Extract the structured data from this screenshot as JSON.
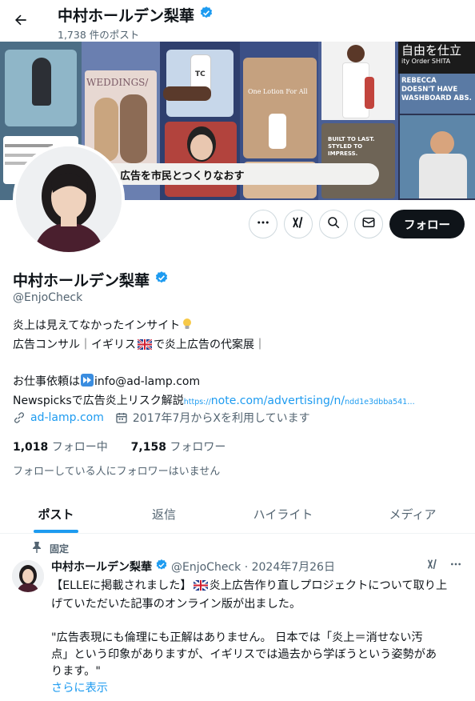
{
  "header": {
    "title": "中村ホールデン梨華",
    "post_count": "1,738 件のポスト"
  },
  "banner": {
    "strip_text": "広告を市民とつくりなおす",
    "weddings_text": "WEDDINGS/",
    "tc_label": "TC",
    "lotion_text": "One Lotion For All",
    "rebecca_text": "REBECCA DOESN'T HAVE WASHBOARD ABS.",
    "built_text": "BUILT TO LAST. STYLED TO IMPRESS.",
    "freedom_text": "自由を仕立",
    "order_text": "ity Order SHITA"
  },
  "profile": {
    "name": "中村ホールデン梨華",
    "handle": "@EnjoCheck",
    "bio_line1": "炎上は見えてなかったインサイト",
    "bio_line2a": "広告コンサル｜イギリス",
    "bio_line2b": "で炎上広告の代案展｜",
    "bio_line4a": "お仕事依頼は",
    "bio_line4b": "info@ad-lamp.com",
    "bio_line5a": "Newspicksで広告炎上リスク解説",
    "bio_line5b": "https://",
    "bio_line5c": "note.com/advertising/n/",
    "bio_line5d": "ndd1e3dbba541…",
    "website": "ad-lamp.com",
    "joined": "2017年7月からXを利用しています",
    "following_count": "1,018",
    "following_label": "フォロー中",
    "followers_count": "7,158",
    "followers_label": "フォロワー",
    "followers_note": "フォローしている人にフォロワーはいません"
  },
  "actions": {
    "follow_label": "フォロー"
  },
  "tabs": [
    "ポスト",
    "返信",
    "ハイライト",
    "メディア"
  ],
  "post": {
    "pinned_label": "固定",
    "author": "中村ホールデン梨華",
    "meta": "@EnjoCheck · 2024年7月26日",
    "line1": "【ELLEに掲載されました】",
    "line1b": "炎上広告作り直しプロジェクトについて取り上",
    "line2": "げていただいた記事のオンライン版が出ました。",
    "line3": "\"広告表現にも倫理にも正解はありません。 日本では「炎上＝消せない汚",
    "line4": "点」という印象がありますが、イギリスでは過去から学ぼうという姿勢があ",
    "line5": "ります。\"",
    "show_more": "さらに表示"
  },
  "colors": {
    "accent": "#1d9bf0",
    "text": "#0f1419",
    "muted": "#536471",
    "follow_bg": "#0f1419"
  }
}
